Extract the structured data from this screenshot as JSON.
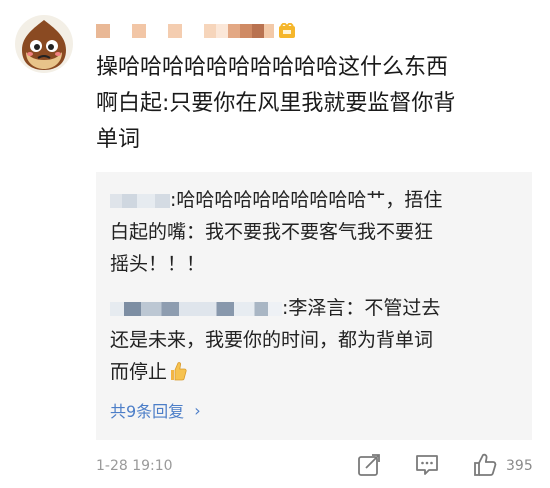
{
  "comment": {
    "post_lines": [
      "操哈哈哈哈哈哈哈哈哈哈这什么东西",
      "啊白起:只要你在风里我就要监督你背",
      "单词"
    ],
    "timestamp": "1-28 19:10",
    "like_count": "395"
  },
  "replies": {
    "reply1_lines": [
      ":哈哈哈哈哈哈哈哈哈哈艹，捂住",
      "白起的嘴：我不要我不要客气我不要狂",
      "摇头！！！"
    ],
    "reply2_lines": [
      ":李泽言：不管过去",
      "还是未来，我要你的时间，都为背单词",
      "而停止"
    ],
    "more_label": "共9条回复",
    "more_arrow": "›"
  },
  "icons": {
    "avatar": "chestnut-avatar",
    "vip": "vip-badge-icon",
    "repost": "repost-icon",
    "comment": "comment-icon",
    "like": "thumbs-up-icon",
    "emoji": "thumbs-up-emoji"
  },
  "colors": {
    "link": "#4c7ec8",
    "reply_bg": "#f5f5f5",
    "meta": "#9a9a9a"
  }
}
